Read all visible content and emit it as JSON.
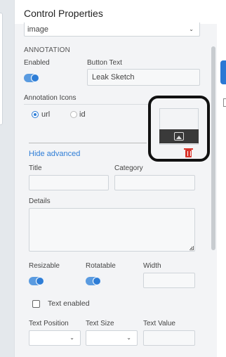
{
  "panel": {
    "title": "Control Properties"
  },
  "type_select": {
    "value": "image"
  },
  "annotation": {
    "section_label": "ANNOTATION",
    "enabled_label": "Enabled",
    "enabled": true,
    "button_text_label": "Button Text",
    "button_text_value": "Leak Sketch",
    "icons_label": "Annotation Icons",
    "source_options": [
      {
        "label": "url",
        "selected": true
      },
      {
        "label": "id",
        "selected": false
      }
    ],
    "hide_advanced_label": "Hide advanced",
    "title_label": "Title",
    "category_label": "Category",
    "details_label": "Details",
    "resizable_label": "Resizable",
    "resizable": true,
    "rotatable_label": "Rotatable",
    "rotatable": true,
    "width_label": "Width",
    "text_enabled_label": "Text enabled",
    "text_enabled": false,
    "text_position_label": "Text Position",
    "text_size_label": "Text Size",
    "text_value_label": "Text Value"
  },
  "icons": {
    "image_placeholder": "image-icon",
    "delete": "trash-icon",
    "chevron": "chevron-down-icon"
  },
  "colors": {
    "accent": "#2e7dd6",
    "delete": "#d9342b"
  }
}
